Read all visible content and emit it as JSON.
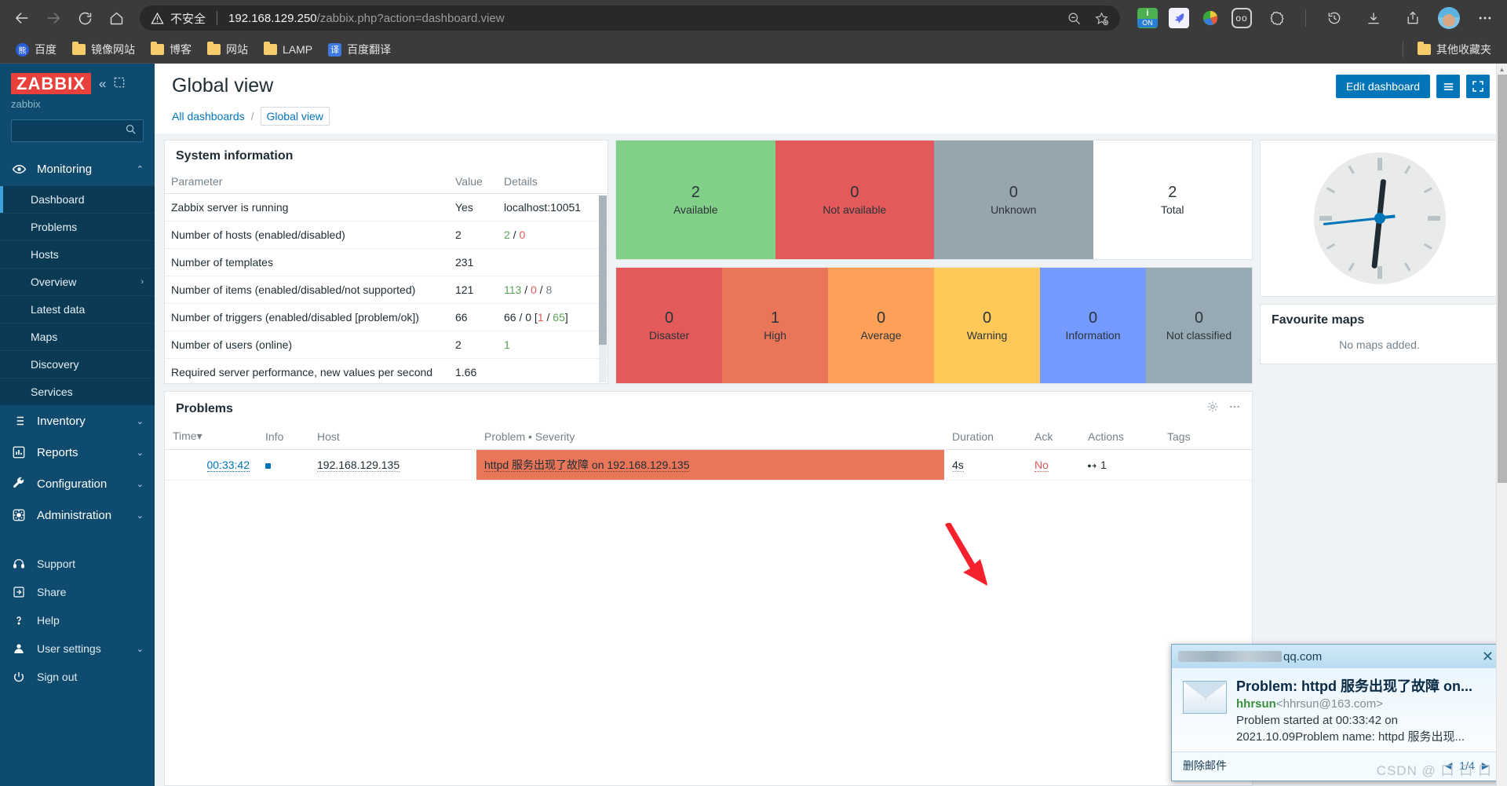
{
  "browser": {
    "back_icon": "back-arrow-icon",
    "forward_icon": "forward-arrow-icon",
    "reload_icon": "reload-icon",
    "home_icon": "home-icon",
    "security_label": "不安全",
    "url_host": "192.168.129.250",
    "url_path": "/zabbix.php?action=dashboard.view",
    "zoom_out_icon": "zoom-out-icon",
    "favourite_icon": "add-favourite-icon",
    "extensions": [
      {
        "name": "noscript-extension-icon",
        "top": "i",
        "label": "ON"
      },
      {
        "name": "bird-extension-icon",
        "glyph": "◀"
      },
      {
        "name": "idm-extension-icon",
        "glyph": ""
      },
      {
        "name": "oo-extension-icon",
        "glyph": "oo"
      }
    ],
    "collections_icon": "collections-icon",
    "history_icon": "history-icon",
    "downloads_icon": "downloads-icon",
    "share_icon": "share-icon",
    "profile_icon": "profile-avatar",
    "more_icon": "more-options-icon"
  },
  "bookmarks": {
    "items": [
      {
        "label": "百度",
        "icon": "baidu-icon"
      },
      {
        "label": "镜像网站",
        "icon": "folder-icon"
      },
      {
        "label": "博客",
        "icon": "folder-icon"
      },
      {
        "label": "网站",
        "icon": "folder-icon"
      },
      {
        "label": "LAMP",
        "icon": "folder-icon"
      },
      {
        "label": "百度翻译",
        "icon": "translate-icon"
      }
    ],
    "other_label": "其他收藏夹"
  },
  "sidebar": {
    "logo": "ZABBIX",
    "subtitle": "zabbix",
    "collapse_icon": "collapse-icon",
    "hide_icon": "hide-sidebar-icon",
    "search_placeholder": "",
    "search_value": "",
    "search_icon": "search-icon",
    "monitoring": {
      "label": "Monitoring",
      "icon": "eye-icon",
      "caret": "⌃",
      "items": [
        {
          "label": "Dashboard",
          "selected": true
        },
        {
          "label": "Problems",
          "selected": false
        },
        {
          "label": "Hosts",
          "selected": false
        },
        {
          "label": "Overview",
          "selected": false,
          "caret": "›"
        },
        {
          "label": "Latest data",
          "selected": false
        },
        {
          "label": "Maps",
          "selected": false
        },
        {
          "label": "Discovery",
          "selected": false
        },
        {
          "label": "Services",
          "selected": false
        }
      ]
    },
    "groups": [
      {
        "label": "Inventory",
        "icon": "list-icon",
        "caret": "⌄"
      },
      {
        "label": "Reports",
        "icon": "bar-chart-icon",
        "caret": "⌄"
      },
      {
        "label": "Configuration",
        "icon": "wrench-icon",
        "caret": "⌄"
      },
      {
        "label": "Administration",
        "icon": "gear-icon",
        "caret": "⌄"
      }
    ],
    "bottom": [
      {
        "label": "Support",
        "icon": "headset-icon"
      },
      {
        "label": "Share",
        "icon": "share-icon"
      },
      {
        "label": "Help",
        "icon": "question-icon"
      },
      {
        "label": "User settings",
        "icon": "user-icon",
        "caret": "⌄"
      },
      {
        "label": "Sign out",
        "icon": "power-icon"
      }
    ]
  },
  "header": {
    "title": "Global view",
    "edit_dashboard_label": "Edit dashboard",
    "menu_icon": "hamburger-menu-icon",
    "fullscreen_icon": "fullscreen-icon"
  },
  "breadcrumb": {
    "all_dashboards": "All dashboards",
    "separator": "/",
    "current": "Global view"
  },
  "system_information": {
    "title": "System information",
    "columns": [
      "Parameter",
      "Value",
      "Details"
    ],
    "rows": [
      {
        "parameter": "Zabbix server is running",
        "value": "Yes",
        "value_color": "green",
        "details": [
          {
            "t": "localhost:10051",
            "c": "dark"
          }
        ]
      },
      {
        "parameter": "Number of hosts (enabled/disabled)",
        "value": "2",
        "value_color": "dark",
        "details": [
          {
            "t": "2",
            "c": "green"
          },
          {
            "t": " / ",
            "c": "dark"
          },
          {
            "t": "0",
            "c": "red"
          }
        ]
      },
      {
        "parameter": "Number of templates",
        "value": "231",
        "value_color": "dark",
        "details": []
      },
      {
        "parameter": "Number of items (enabled/disabled/not supported)",
        "value": "121",
        "value_color": "dark",
        "details": [
          {
            "t": "113",
            "c": "green"
          },
          {
            "t": " / ",
            "c": "dark"
          },
          {
            "t": "0",
            "c": "red"
          },
          {
            "t": " / ",
            "c": "dark"
          },
          {
            "t": "8",
            "c": "grey"
          }
        ]
      },
      {
        "parameter": "Number of triggers (enabled/disabled [problem/ok])",
        "value": "66",
        "value_color": "dark",
        "details": [
          {
            "t": "66 / 0 [",
            "c": "dark"
          },
          {
            "t": "1",
            "c": "red"
          },
          {
            "t": " / ",
            "c": "dark"
          },
          {
            "t": "65",
            "c": "green"
          },
          {
            "t": "]",
            "c": "dark"
          }
        ]
      },
      {
        "parameter": "Number of users (online)",
        "value": "2",
        "value_color": "dark",
        "details": [
          {
            "t": "1",
            "c": "green"
          }
        ]
      },
      {
        "parameter": "Required server performance, new values per second",
        "value": "1.66",
        "value_color": "dark",
        "details": []
      }
    ]
  },
  "host_availability": {
    "tiles": [
      {
        "count": "2",
        "label": "Available",
        "color": "#82cf88"
      },
      {
        "count": "0",
        "label": "Not available",
        "color": "#e45959"
      },
      {
        "count": "0",
        "label": "Unknown",
        "color": "#97a5ae"
      },
      {
        "count": "2",
        "label": "Total",
        "color": "#ffffff"
      }
    ]
  },
  "problems_by_severity": {
    "tiles": [
      {
        "count": "0",
        "label": "Disaster",
        "color": "#e45959"
      },
      {
        "count": "1",
        "label": "High",
        "color": "#e97659"
      },
      {
        "count": "0",
        "label": "Average",
        "color": "#ffa059"
      },
      {
        "count": "0",
        "label": "Warning",
        "color": "#ffc859"
      },
      {
        "count": "0",
        "label": "Information",
        "color": "#7499ff"
      },
      {
        "count": "0",
        "label": "Not classified",
        "color": "#97aab3"
      }
    ]
  },
  "clock": {
    "hour_deg": 6,
    "minute_deg": 186,
    "second_deg": 264
  },
  "favourite_maps": {
    "title": "Favourite maps",
    "empty_text": "No maps added."
  },
  "problems": {
    "title": "Problems",
    "gear_icon": "gear-icon",
    "more_icon": "more-options-icon",
    "columns": [
      "Time",
      "Info",
      "Host",
      "Problem • Severity",
      "Duration",
      "Ack",
      "Actions",
      "Tags"
    ],
    "sort_indicator": "▾",
    "rows": [
      {
        "time": "00:33:42",
        "info": "",
        "host": "192.168.129.135",
        "problem": "httpd 服务出现了故障 on 192.168.129.135",
        "severity_color": "#e97659",
        "duration": "4s",
        "ack": "No",
        "actions": "1",
        "tags": ""
      }
    ]
  },
  "mail_popup": {
    "account_suffix": "qq.com",
    "close_icon": "close-icon",
    "envelope_icon": "envelope-icon",
    "subject": "Problem: httpd 服务出现了故障 on...",
    "sender_name": "hhrsun",
    "sender_email": "<hhrsun@163.com>",
    "body_line1": "Problem started at 00:33:42 on",
    "body_line2": "2021.10.09Problem name: httpd 服务出现...",
    "delete_label": "删除邮件",
    "prev_icon": "prev-arrow-icon",
    "next_icon": "next-arrow-icon",
    "page_indicator": "1/4"
  },
  "watermark": {
    "text": "CSDN @ 口 口 口"
  }
}
